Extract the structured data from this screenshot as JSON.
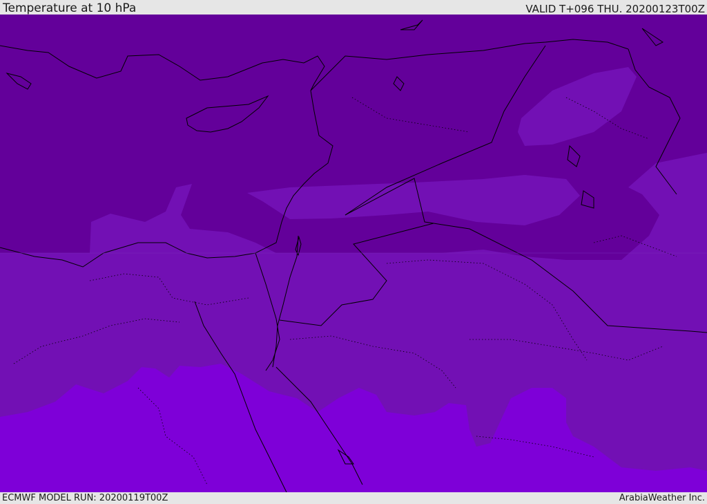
{
  "header": {
    "title": "Temperature at 10 hPa",
    "valid": "VALID T+096 THU. 20200123T00Z"
  },
  "footer": {
    "model_run": "ECMWF MODEL RUN: 20200119T00Z",
    "credit": "ArabiaWeather Inc."
  },
  "map": {
    "colors": {
      "band_dark": "#63009a",
      "band_mid": "#7210b4",
      "band_light": "#7e00d8",
      "borders": "#000000"
    }
  }
}
